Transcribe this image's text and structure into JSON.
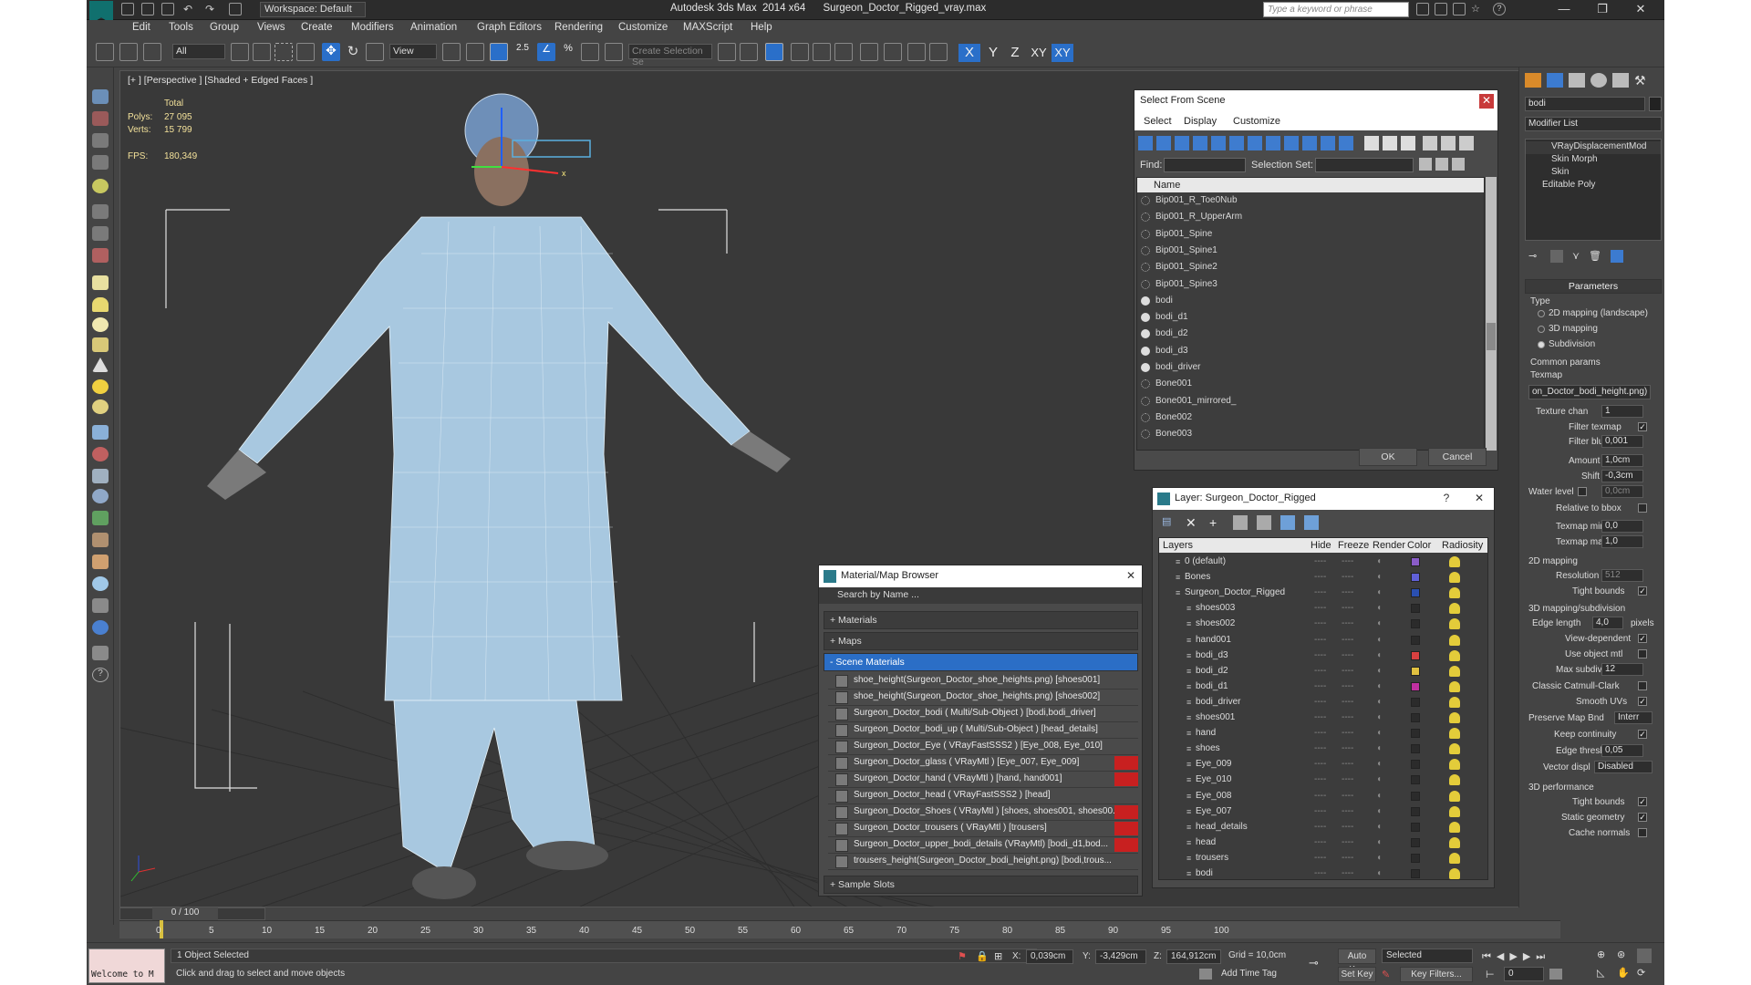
{
  "app": {
    "title": "Autodesk 3ds Max  2014 x64      Surgeon_Doctor_Rigged_vray.max",
    "workspace": "Workspace: Default",
    "search_placeholder": "Type a keyword or phrase"
  },
  "menu": [
    "Edit",
    "Tools",
    "Group",
    "Views",
    "Create",
    "Modifiers",
    "Animation",
    "Graph Editors",
    "Rendering",
    "Customize",
    "MAXScript",
    "Help"
  ],
  "toolbar": {
    "filter_value": "All",
    "coord_value": "View",
    "snap_label": "2.5",
    "selection_set_placeholder": "Create Selection Se",
    "axes": [
      "X",
      "Y",
      "Z",
      "XY",
      "XY"
    ]
  },
  "viewport": {
    "label": "[+ ] [Perspective ] [Shaded + Edged Faces ]",
    "stats": {
      "total": "Total",
      "polys_label": "Polys:",
      "polys": "27 095",
      "verts_label": "Verts:",
      "verts": "15 799",
      "fps_label": "FPS:",
      "fps": "180,349"
    }
  },
  "select_from_scene": {
    "title": "Select From Scene",
    "menu": [
      "Select",
      "Display",
      "Customize"
    ],
    "find_label": "Find:",
    "selection_set_label": "Selection Set:",
    "column": "Name",
    "items": [
      "Bip001_R_Toe0Nub",
      "Bip001_R_UpperArm",
      "Bip001_Spine",
      "Bip001_Spine1",
      "Bip001_Spine2",
      "Bip001_Spine3",
      "bodi",
      "bodi_d1",
      "bodi_d2",
      "bodi_d3",
      "bodi_driver",
      "Bone001",
      "Bone001_mirrored_",
      "Bone002",
      "Bone003"
    ],
    "ok": "OK",
    "cancel": "Cancel"
  },
  "material_browser": {
    "title": "Material/Map Browser",
    "search_placeholder": "Search by Name ...",
    "categories": [
      "+ Materials",
      "+ Maps",
      "- Scene Materials",
      "+ Sample Slots"
    ],
    "items": [
      {
        "text": "shoe_height(Surgeon_Doctor_shoe_heights.png) [shoes001]",
        "red": false
      },
      {
        "text": "shoe_height(Surgeon_Doctor_shoe_heights.png) [shoes002]",
        "red": false
      },
      {
        "text": "Surgeon_Doctor_bodi ( Multi/Sub-Object ) [bodi,bodi_driver]",
        "red": false
      },
      {
        "text": "Surgeon_Doctor_bodi_up ( Multi/Sub-Object ) [head_details]",
        "red": false
      },
      {
        "text": "Surgeon_Doctor_Eye ( VRayFastSSS2 ) [Eye_008, Eye_010]",
        "red": false
      },
      {
        "text": "Surgeon_Doctor_glass ( VRayMtl ) [Eye_007, Eye_009]",
        "red": true
      },
      {
        "text": "Surgeon_Doctor_hand ( VRayMtl ) [hand, hand001]",
        "red": true
      },
      {
        "text": "Surgeon_Doctor_head ( VRayFastSSS2 ) [head]",
        "red": false
      },
      {
        "text": "Surgeon_Doctor_Shoes ( VRayMtl ) [shoes, shoes001, shoes00...",
        "red": true
      },
      {
        "text": "Surgeon_Doctor_trousers ( VRayMtl ) [trousers]",
        "red": true
      },
      {
        "text": "Surgeon_Doctor_upper_bodi_details (VRayMtl) [bodi_d1,bod...",
        "red": true
      },
      {
        "text": "trousers_height(Surgeon_Doctor_bodi_height.png) [bodi,trous...",
        "red": false
      }
    ]
  },
  "layer_dialog": {
    "title": "Layer: Surgeon_Doctor_Rigged",
    "help": "?",
    "columns": [
      "Layers",
      "Hide",
      "Freeze",
      "Render",
      "Color",
      "Radiosity"
    ],
    "rows": [
      {
        "name": "0 (default)",
        "indent": 0,
        "color": "#8a5cc8"
      },
      {
        "name": "Bones",
        "indent": 0,
        "color": "#6060d8"
      },
      {
        "name": "Surgeon_Doctor_Rigged",
        "indent": 0,
        "color": "#2a4fb0"
      },
      {
        "name": "shoes003",
        "indent": 1,
        "color": "#2b2b2b"
      },
      {
        "name": "shoes002",
        "indent": 1,
        "color": "#2b2b2b"
      },
      {
        "name": "hand001",
        "indent": 1,
        "color": "#2b2b2b"
      },
      {
        "name": "bodi_d3",
        "indent": 1,
        "color": "#d84040"
      },
      {
        "name": "bodi_d2",
        "indent": 1,
        "color": "#e0c040"
      },
      {
        "name": "bodi_d1",
        "indent": 1,
        "color": "#c030a0"
      },
      {
        "name": "bodi_driver",
        "indent": 1,
        "color": "#2b2b2b"
      },
      {
        "name": "shoes001",
        "indent": 1,
        "color": "#2b2b2b"
      },
      {
        "name": "hand",
        "indent": 1,
        "color": "#2b2b2b"
      },
      {
        "name": "shoes",
        "indent": 1,
        "color": "#2b2b2b"
      },
      {
        "name": "Eye_009",
        "indent": 1,
        "color": "#2b2b2b"
      },
      {
        "name": "Eye_010",
        "indent": 1,
        "color": "#2b2b2b"
      },
      {
        "name": "Eye_008",
        "indent": 1,
        "color": "#2b2b2b"
      },
      {
        "name": "Eye_007",
        "indent": 1,
        "color": "#2b2b2b"
      },
      {
        "name": "head_details",
        "indent": 1,
        "color": "#2b2b2b"
      },
      {
        "name": "head",
        "indent": 1,
        "color": "#2b2b2b"
      },
      {
        "name": "trousers",
        "indent": 1,
        "color": "#2b2b2b"
      },
      {
        "name": "bodi",
        "indent": 1,
        "color": "#2b2b2b"
      }
    ]
  },
  "command_panel": {
    "name_field": "bodi",
    "modifier_list": "Modifier List",
    "stack": [
      "VRayDisplacementMod",
      "Skin Morph",
      "Skin",
      "Editable Poly"
    ],
    "parameters": "Parameters",
    "type_label": "Type",
    "type_options": [
      "2D mapping (landscape)",
      "3D mapping",
      "Subdivision"
    ],
    "common_params": "Common params",
    "texmap_label": "Texmap",
    "texmap_value": "on_Doctor_bodi_height.png)",
    "texture_chan_label": "Texture chan",
    "texture_chan": "1",
    "filter_texmap": "Filter texmap",
    "filter_blur_label": "Filter blur",
    "filter_blur": "0,001",
    "amount_label": "Amount",
    "amount": "1,0cm",
    "shift_label": "Shift",
    "shift": "-0,3cm",
    "water_level_label": "Water level",
    "water_level": "0,0cm",
    "relative_bbox": "Relative to bbox",
    "texmap_min_label": "Texmap min",
    "texmap_min": "0,0",
    "texmap_max_label": "Texmap max",
    "texmap_max": "1,0",
    "mapping2d": "2D mapping",
    "resolution_label": "Resolution",
    "resolution": "512",
    "tight_bounds": "Tight bounds",
    "mapping3d": "3D mapping/subdivision",
    "edge_length_label": "Edge length",
    "edge_length": "4,0",
    "pixels": "pixels",
    "view_dependent": "View-dependent",
    "use_object_mtl": "Use object mtl",
    "max_subdivs_label": "Max subdivs",
    "max_subdivs": "12",
    "classic_catmull": "Classic Catmull-Clark",
    "smooth_uvs": "Smooth UVs",
    "preserve_map_label": "Preserve Map Bnd",
    "preserve_map": "Interr",
    "keep_continuity": "Keep continuity",
    "edge_thresh_label": "Edge thresh",
    "edge_thresh": "0,05",
    "vector_displ_label": "Vector displ",
    "vector_displ": "Disabled",
    "performance": "3D performance",
    "perf_tight_bounds": "Tight bounds",
    "static_geometry": "Static geometry",
    "cache_normals": "Cache normals"
  },
  "timeline": {
    "frame": "0 / 100",
    "ticks": [
      "0",
      "5",
      "10",
      "15",
      "20",
      "25",
      "30",
      "35",
      "40",
      "45",
      "50",
      "55",
      "60",
      "65",
      "70",
      "75",
      "80",
      "85",
      "90",
      "95",
      "100"
    ]
  },
  "status": {
    "maxscript": "Welcome to M",
    "selected": "1 Object Selected",
    "prompt": "Click and drag to select and move objects",
    "x_label": "X:",
    "x": "0,039cm",
    "y_label": "Y:",
    "y": "-3,429cm",
    "z_label": "Z:",
    "z": "164,912cm",
    "grid": "Grid = 10,0cm",
    "add_time_tag": "Add Time Tag",
    "auto_key": "Auto Key",
    "selected_dropdown": "Selected",
    "set_key": "Set Key",
    "key_filters": "Key Filters...",
    "frame_field": "0"
  }
}
